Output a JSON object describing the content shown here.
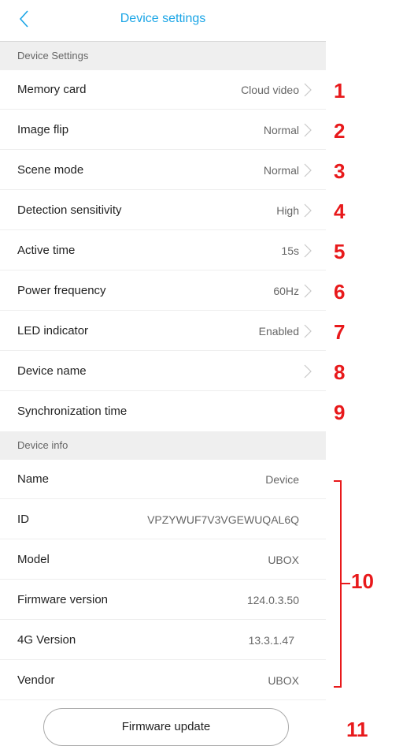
{
  "header": {
    "title": "Device settings"
  },
  "sections": {
    "settings_title": "Device Settings",
    "info_title": "Device info"
  },
  "settings": [
    {
      "label": "Memory card",
      "value": "Cloud video"
    },
    {
      "label": "Image flip",
      "value": "Normal"
    },
    {
      "label": "Scene mode",
      "value": "Normal"
    },
    {
      "label": "Detection sensitivity",
      "value": "High"
    },
    {
      "label": "Active time",
      "value": "15s"
    },
    {
      "label": "Power frequency",
      "value": "60Hz"
    },
    {
      "label": "LED indicator",
      "value": "Enabled"
    },
    {
      "label": "Device name",
      "value": ""
    },
    {
      "label": "Synchronization time",
      "value": ""
    }
  ],
  "info": [
    {
      "label": "Name",
      "value": "Device"
    },
    {
      "label": "ID",
      "value": "VPZYWUF7V3VGEWUQAL6Q"
    },
    {
      "label": "Model",
      "value": "UBOX"
    },
    {
      "label": "Firmware version",
      "value": "124.0.3.50"
    },
    {
      "label": "4G Version",
      "value": "13.3.1.47"
    },
    {
      "label": "Vendor",
      "value": "UBOX"
    }
  ],
  "firmware_button": "Firmware update",
  "annotations": [
    "1",
    "2",
    "3",
    "4",
    "5",
    "6",
    "7",
    "8",
    "9",
    "10",
    "11"
  ],
  "colors": {
    "accent": "#1aa5e6",
    "annotation": "#e8191b",
    "section_bg": "#efefef"
  },
  "icons": {
    "back": "chevron-left-icon",
    "row": "chevron-right-icon"
  }
}
